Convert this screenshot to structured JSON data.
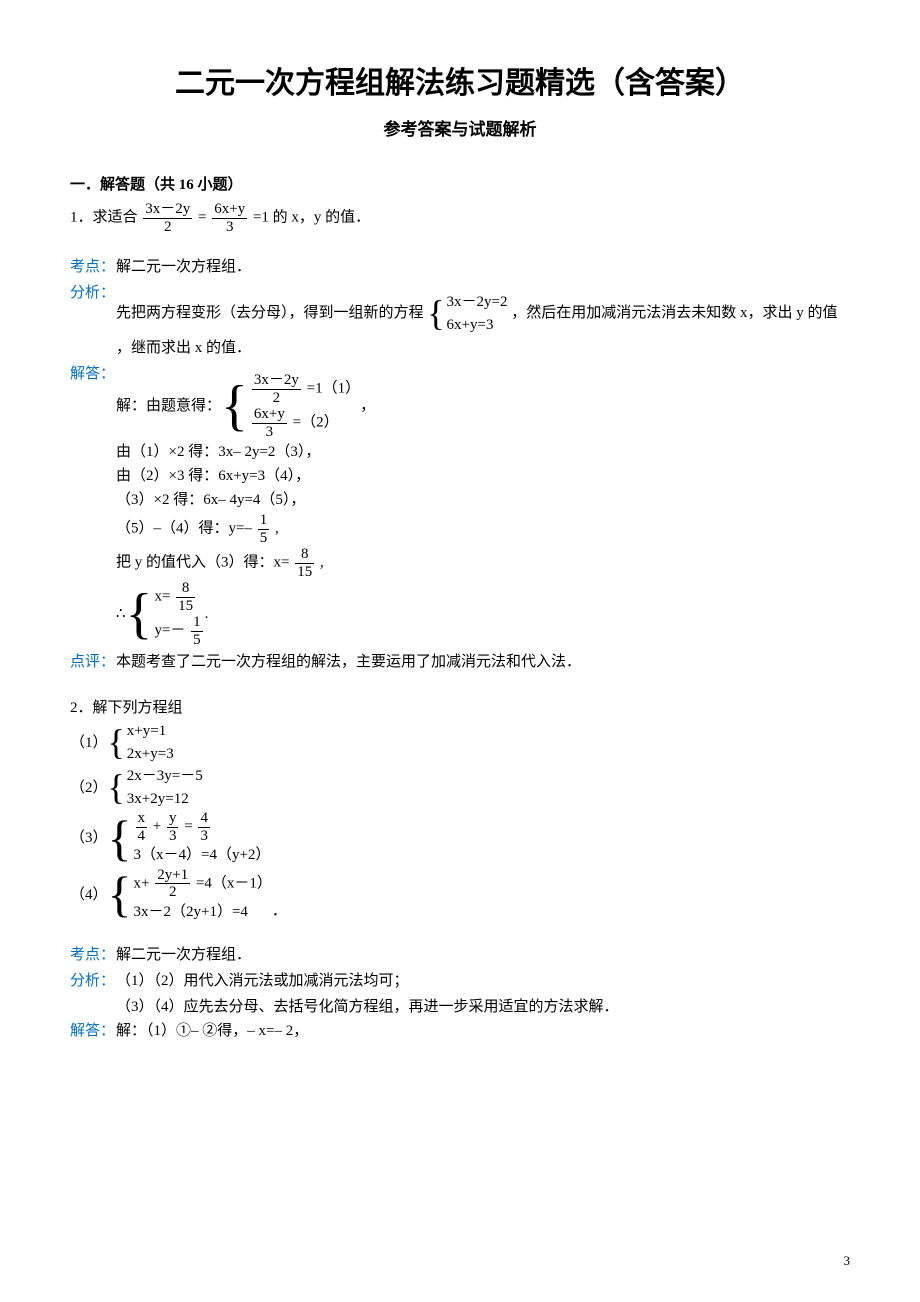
{
  "title": "二元一次方程组解法练习题精选（含答案）",
  "subtitle": "参考答案与试题解析",
  "section": "一．解答题（共 16 小题）",
  "q1": {
    "stem_prefix": "1．求适合",
    "frac1_num": "3x－2y",
    "frac1_den": "2",
    "eq": "=",
    "frac2_num": "6x+y",
    "frac2_den": "3",
    "stem_suffix": "=1 的 x，y 的值．",
    "kaodian_label": "考点：",
    "kaodian": "解二元一次方程组．",
    "fenxi_label": "分析：",
    "fenxi_prefix": "先把两方程变形（去分母），得到一组新的方程",
    "fenxi_sys_a": "3x－2y=2",
    "fenxi_sys_b": "6x+y=3",
    "fenxi_mid": "，然后在用加减消元法消去未知数 x，求出 y 的值",
    "fenxi_tail": "，继而求出 x 的值．",
    "jieda_label": "解答：",
    "jieda_prefix": "解：由题意得：",
    "jieda_sys_a_num": "3x－2y",
    "jieda_sys_a_den": "2",
    "jieda_sys_a_tail": "=1（1）",
    "jieda_sys_b_num": "6x+y",
    "jieda_sys_b_den": "3",
    "jieda_sys_b_tail": "=（2）",
    "jieda_comma": "，",
    "step1": "由（1）×2 得：3x– 2y=2（3），",
    "step2": "由（2）×3 得：6x+y=3（4），",
    "step3": "（3）×2 得：6x– 4y=4（5），",
    "step4_prefix": "（5）–（4）得：y=–",
    "step4_num": "1",
    "step4_den": "5",
    "step4_tail": ",",
    "step5_prefix": "把 y 的值代入（3）得：x=",
    "step5_num": "8",
    "step5_den": "15",
    "step5_tail": ",",
    "final_prefix": "∴",
    "final_a_pre": "x=",
    "final_a_num": "8",
    "final_a_den": "15",
    "final_b_pre": "y=－",
    "final_b_num": "1",
    "final_b_den": "5",
    "final_tail": ".",
    "dianping_label": "点评：",
    "dianping": "本题考查了二元一次方程组的解法，主要运用了加减消元法和代入法．"
  },
  "q2": {
    "stem": "2．解下列方程组",
    "p1_label": "（1）",
    "p1_a": "x+y=1",
    "p1_b": "2x+y=3",
    "p2_label": "（2）",
    "p2_a": "2x－3y=－5",
    "p2_b": "3x+2y=12",
    "p3_label": "（3）",
    "p3_a_x_num": "x",
    "p3_a_x_den": "4",
    "p3_a_plus": "+",
    "p3_a_y_num": "y",
    "p3_a_y_den": "3",
    "p3_a_eq": "=",
    "p3_a_r_num": "4",
    "p3_a_r_den": "3",
    "p3_b": "3（x－4）=4（y+2）",
    "p4_label": "（4）",
    "p4_a_pre": "x+",
    "p4_a_num": "2y+1",
    "p4_a_den": "2",
    "p4_a_post": "=4（x－1）",
    "p4_b": "3x－2（2y+1）=4",
    "p4_tail": "．",
    "kaodian_label": "考点：",
    "kaodian": "解二元一次方程组．",
    "fenxi_label": "分析：",
    "fenxi1": "（1）（2）用代入消元法或加减消元法均可；",
    "fenxi2": "（3）（4）应先去分母、去括号化简方程组，再进一步采用适宜的方法求解．",
    "jieda_label": "解答：",
    "jieda": "解：（1）①– ②得，– x=– 2，"
  },
  "page": "3",
  "chart_data": null
}
